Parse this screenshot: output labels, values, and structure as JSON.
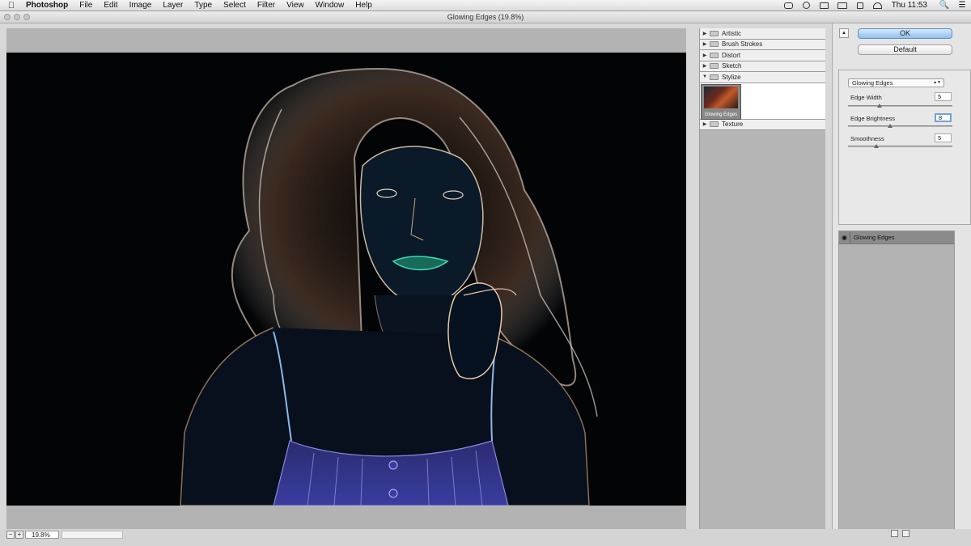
{
  "menubar": {
    "app_name": "Photoshop",
    "items": [
      "File",
      "Edit",
      "Image",
      "Layer",
      "Type",
      "Select",
      "Filter",
      "View",
      "Window",
      "Help"
    ],
    "clock": "Thu 11:53"
  },
  "window": {
    "title": "Glowing Edges (19.8%)"
  },
  "status": {
    "zoom": "19.8%"
  },
  "gallery": {
    "folders": [
      {
        "label": "Artistic",
        "expanded": false
      },
      {
        "label": "Brush Strokes",
        "expanded": false
      },
      {
        "label": "Distort",
        "expanded": false
      },
      {
        "label": "Sketch",
        "expanded": false
      },
      {
        "label": "Stylize",
        "expanded": true
      },
      {
        "label": "Texture",
        "expanded": false
      }
    ],
    "thumbnail_label": "Glowing Edges"
  },
  "buttons": {
    "ok": "OK",
    "default": "Default"
  },
  "settings": {
    "filter_name": "Glowing Edges",
    "params": [
      {
        "label": "Edge Width",
        "value": "5",
        "slider_fraction": 0.3
      },
      {
        "label": "Edge Brightness",
        "value": "8",
        "slider_fraction": 0.4
      },
      {
        "label": "Smoothness",
        "value": "5",
        "slider_fraction": 0.27
      }
    ]
  },
  "layers": {
    "items": [
      "Glowing Edges"
    ]
  },
  "colors": {
    "ok_button": "#8fc0ef",
    "canvas_bg": "#020406"
  }
}
